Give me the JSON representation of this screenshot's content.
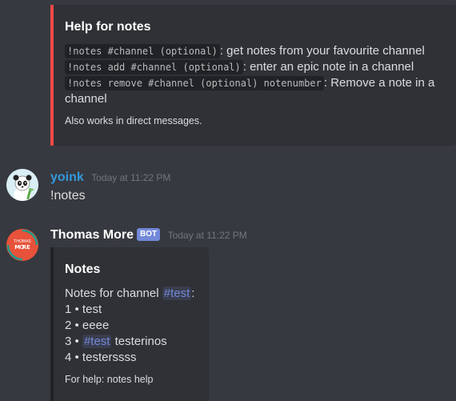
{
  "help_embed": {
    "title": "Help for notes",
    "lines": [
      {
        "code": "!notes #channel (optional)",
        "text": ": get notes from your favourite channel"
      },
      {
        "code": "!notes add #channel (optional)",
        "text": ": enter an epic note in a channel"
      },
      {
        "code": "!notes remove #channel (optional) notenumber",
        "text": ": Remove a note in a"
      },
      {
        "text": "channel"
      }
    ],
    "footer": "Also works in direct messages.",
    "accent_color": "#f04747"
  },
  "messages": [
    {
      "username": "yoink",
      "username_color": "#3498db",
      "timestamp": "Today at 11:22 PM",
      "content": "!notes"
    },
    {
      "username": "Thomas More",
      "username_color": "#ffffff",
      "bot_tag": "BOT",
      "timestamp": "Today at 11:22 PM",
      "avatar_text_top": "THOMAS",
      "avatar_text_bottom": "M  RE"
    }
  ],
  "notes_embed": {
    "title": "Notes",
    "header_prefix": "Notes for channel ",
    "header_channel": "#test",
    "header_suffix": ":",
    "items": [
      {
        "num": "1 •",
        "text": " test"
      },
      {
        "num": "2 •",
        "text": " eeee"
      },
      {
        "num": "3 •",
        "channel": "#test",
        "text": " testerinos"
      },
      {
        "num": "4 •",
        "text": " testerssss"
      }
    ],
    "footer": "For help: notes help"
  }
}
